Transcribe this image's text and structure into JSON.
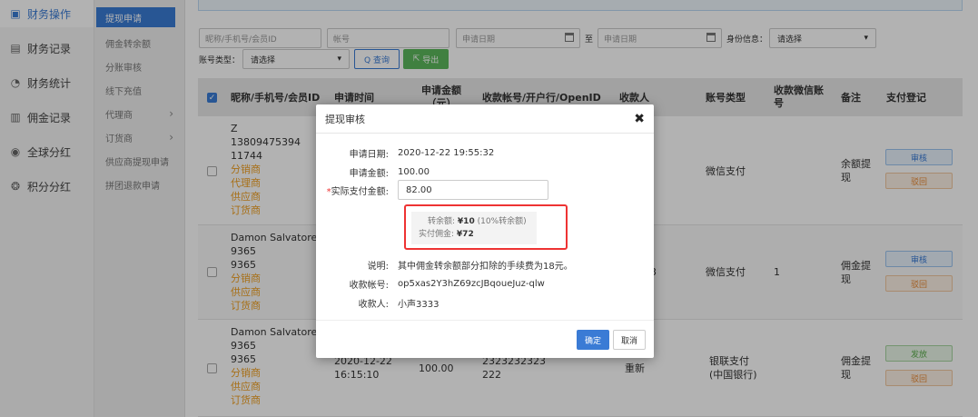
{
  "sidebar": {
    "items": [
      {
        "label": "财务操作",
        "icon": "finance-op-icon"
      },
      {
        "label": "财务记录",
        "icon": "record-icon"
      },
      {
        "label": "财务统计",
        "icon": "stats-icon"
      },
      {
        "label": "佣金记录",
        "icon": "commission-icon"
      },
      {
        "label": "全球分红",
        "icon": "globe-icon"
      },
      {
        "label": "积分分红",
        "icon": "points-icon"
      }
    ]
  },
  "subnav": {
    "items": [
      {
        "label": "提现申请"
      },
      {
        "label": "佣金转余额"
      },
      {
        "label": "分账审核"
      },
      {
        "label": "线下充值"
      },
      {
        "label": "代理商",
        "arrow": "›"
      },
      {
        "label": "订货商",
        "arrow": "›"
      },
      {
        "label": "供应商提现申请"
      },
      {
        "label": "拼团退款申请"
      }
    ]
  },
  "filters": {
    "nickname_placeholder": "昵称/手机号/会员ID",
    "account_placeholder": "帐号",
    "date_start_placeholder": "申请日期",
    "to_label": "至",
    "date_end_placeholder": "申请日期",
    "identity_label": "身份信息：",
    "identity_value": "请选择",
    "account_type_label": "账号类型：",
    "account_type_value": "请选择",
    "query_label": "Q 查询",
    "export_label": "导出"
  },
  "table": {
    "headers": [
      "昵称/手机号/会员ID",
      "申请时间",
      "申请金额（元）",
      "收款帐号/开户行/OpenID",
      "收款人",
      "账号类型",
      "收款微信账号",
      "备注",
      "支付登记"
    ],
    "rows": [
      {
        "user": [
          "Z",
          "13809475394",
          "11744"
        ],
        "roles": [
          "分销商",
          "代理商",
          "供应商",
          "订货商"
        ],
        "account_type": "微信支付",
        "wechat": "",
        "remark": "余额提现",
        "actions": [
          "审核",
          "驳回"
        ]
      },
      {
        "user": [
          "Damon Salvatore",
          "9365",
          "9365"
        ],
        "roles": [
          "分销商",
          "供应商",
          "订货商"
        ],
        "payee_tail": "3",
        "account_type": "微信支付",
        "wechat": "1",
        "remark": "佣金提现",
        "actions": [
          "审核",
          "驳回"
        ]
      },
      {
        "user": [
          "Damon Salvatore",
          "9365",
          "9365"
        ],
        "roles": [
          "分销商",
          "供应商",
          "订货商"
        ],
        "time": [
          "2020-12-22",
          "16:15:10"
        ],
        "amount": "100.00",
        "account": [
          "2323232323",
          "222"
        ],
        "payee": "重新",
        "account_type": "银联支付",
        "account_type2": "(中国银行)",
        "wechat": "",
        "remark": "佣金提现",
        "actions": [
          "发放",
          "驳回"
        ]
      }
    ]
  },
  "modal": {
    "title": "提现审核",
    "close": "✖",
    "date_label": "申请日期:",
    "date_value": "2020-12-22 19:55:32",
    "amount_label": "申请金额:",
    "amount_value": "100.00",
    "actual_label": "实际支付金额:",
    "actual_value": "82.00",
    "to_balance_label": "转余额:",
    "to_balance_value": "¥10",
    "to_balance_note": "(10%转余额)",
    "actual_commission_label": "实付佣金:",
    "actual_commission_value": "¥72",
    "desc_label": "说明:",
    "desc_value": "其中佣金转余额部分扣除的手续费为18元。",
    "account_label": "收款帐号:",
    "account_value": "op5xas2Y3hZ69zcJBqoueJuz-qlw",
    "payee_label": "收款人:",
    "payee_value": "小声3333",
    "confirm_label": "确定",
    "cancel_label": "取消"
  },
  "colors": {
    "accent": "#3a7bd5",
    "highlight_border": "#e33333",
    "role_text": "#f0a021",
    "export_green": "#5cb85c"
  }
}
